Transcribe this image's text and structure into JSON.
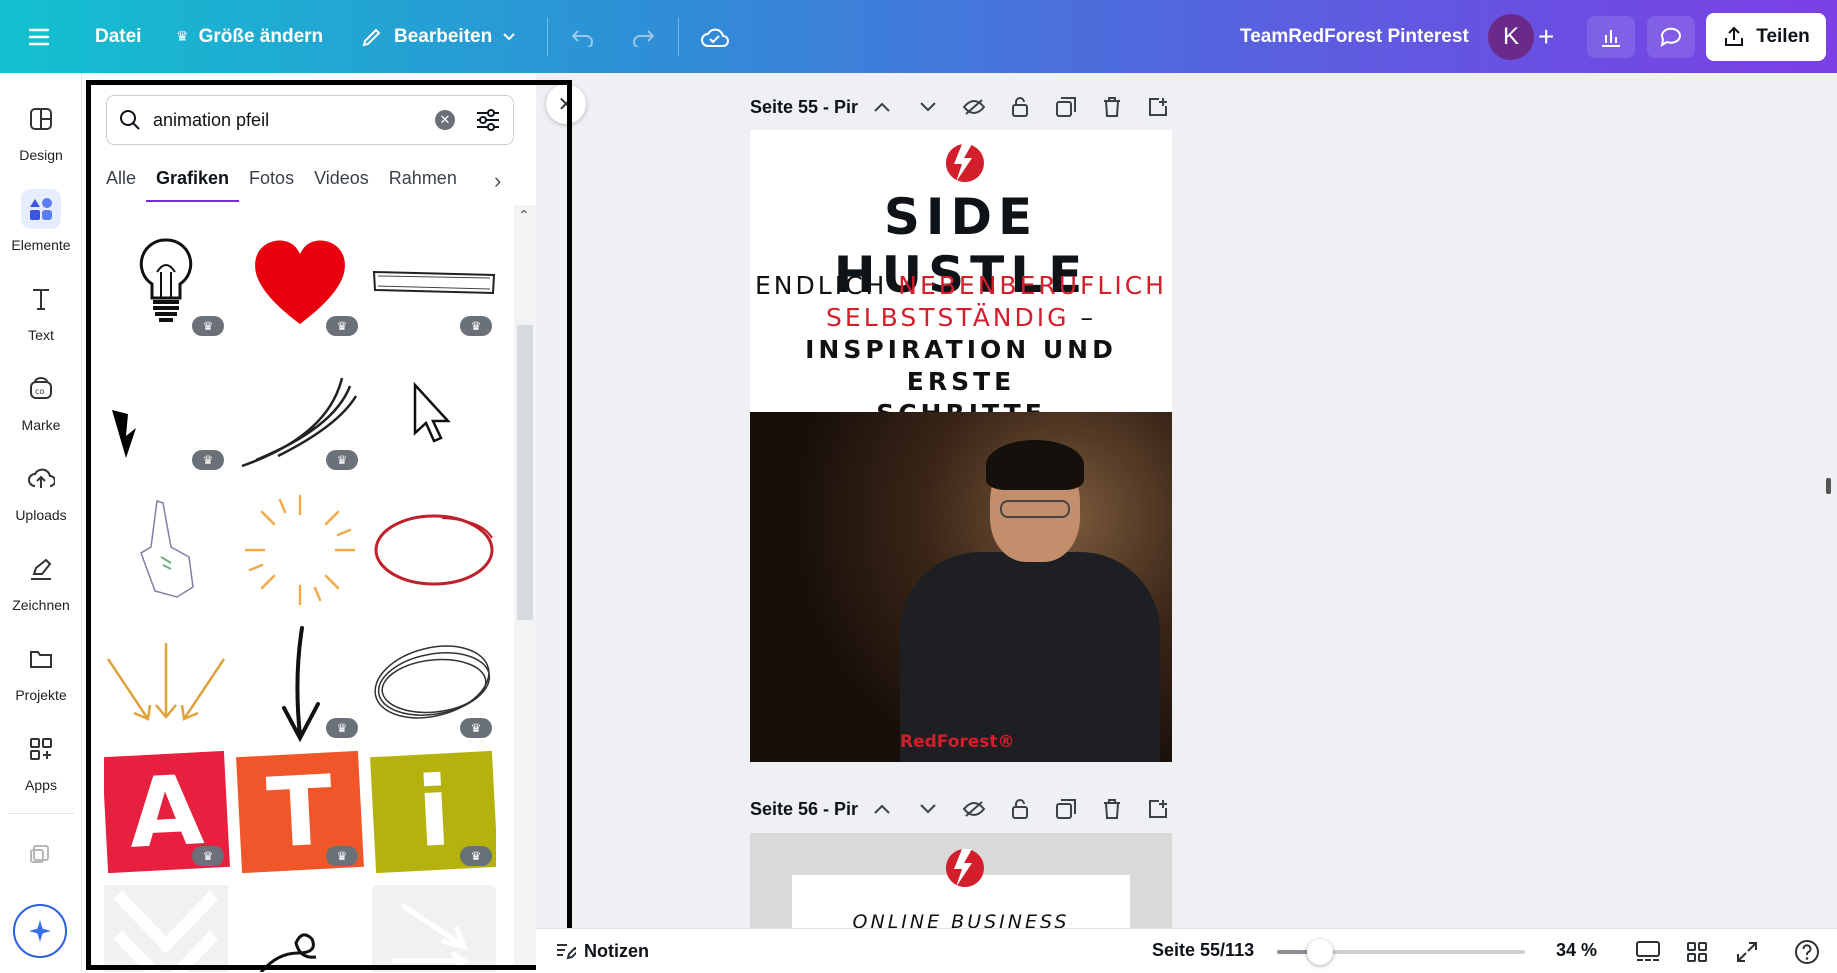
{
  "topbar": {
    "menu_icon": "hamburger-icon",
    "file_label": "Datei",
    "resize_label": "Größe ändern",
    "edit_label": "Bearbeiten",
    "project_title": "TeamRedForest Pinterest",
    "avatar_initial": "K",
    "share_label": "Teilen"
  },
  "rail": {
    "items": [
      {
        "label": "Design",
        "icon": "layout-icon"
      },
      {
        "label": "Elemente",
        "icon": "shapes-icon"
      },
      {
        "label": "Text",
        "icon": "text-icon"
      },
      {
        "label": "Marke",
        "icon": "brand-icon"
      },
      {
        "label": "Uploads",
        "icon": "cloud-upload-icon"
      },
      {
        "label": "Zeichnen",
        "icon": "pen-icon"
      },
      {
        "label": "Projekte",
        "icon": "folder-icon"
      },
      {
        "label": "Apps",
        "icon": "apps-icon"
      }
    ],
    "active": "Elemente"
  },
  "panel": {
    "search_value": "animation pfeil",
    "tabs": [
      "Alle",
      "Grafiken",
      "Fotos",
      "Videos",
      "Rahmen"
    ],
    "active_tab": "Grafiken",
    "letters": [
      "A",
      "T",
      "i"
    ],
    "premium_icon": "crown-icon"
  },
  "canvas": {
    "page1_label": "Seite 55 - Pir",
    "page2_label": "Seite 56 - Pir",
    "page1": {
      "title": "SIDE HUSTLE",
      "line1_a": "ENDLICH ",
      "line1_b": "NEBENBERUFLICH",
      "line2_a": "SELBSTSTÄNDIG",
      "line2_b": " –",
      "line3": "INSPIRATION UND ERSTE",
      "line4": "SCHRITTE",
      "photo_brand": "RedForest®"
    },
    "page2": {
      "text": "ONLINE BUSINESS"
    }
  },
  "footer": {
    "notes_label": "Notizen",
    "page_counter": "Seite 55/113",
    "zoom_label": "34 %",
    "zoom_percent": 34
  },
  "colors": {
    "accent": "#7d2ae8",
    "brand_red": "#d21f2b"
  }
}
